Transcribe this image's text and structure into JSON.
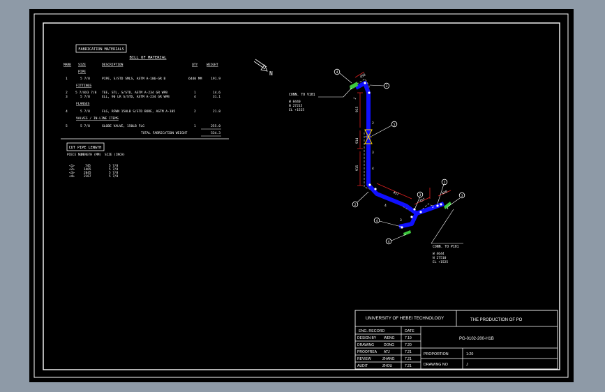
{
  "colors": {
    "background": "#000000",
    "viewport_frame": "#8e9aa7",
    "linework": "#ffffff",
    "pipe": "#1010ff",
    "dimension": "#e02020",
    "fitting": "#ffd400",
    "anchor": "#3ec83e"
  },
  "bom": {
    "badge": "FABRICATION MATERIALS",
    "title": "BILL OF MATERIAL",
    "headers": [
      "MARK",
      "SIZE",
      "DESCRIPTION",
      "QTY",
      "WEIGHT"
    ],
    "sections": [
      {
        "label": "PIPE",
        "rows": [
          {
            "mark": "1",
            "size": "5 7/8",
            "desc": "PIPE, S/STD SMLS, ASTM A-106-GR B",
            "qty": "6440 MM",
            "weight": "191.9"
          }
        ]
      },
      {
        "label": "FITTINGS",
        "rows": [
          {
            "mark": "2",
            "size": "5 7/8X3 7/8",
            "desc": "TEE, STL, S/STD, ASTM A-234 GR WPB",
            "qty": "1",
            "weight": "14.6"
          },
          {
            "mark": "3",
            "size": "5 7/8",
            "desc": "ELL, 90 LR S/STD, ASTM A-234 GR WPB",
            "qty": "4",
            "weight": "31.1"
          }
        ]
      },
      {
        "label": "FLANGES",
        "rows": [
          {
            "mark": "4",
            "size": "5 7/8",
            "desc": "FLG, RFWN 150LB S/STD BORE, ASTM A-105",
            "qty": "2",
            "weight": "21.8"
          }
        ]
      },
      {
        "label": "VALVES / IN-LINE ITEMS",
        "rows": [
          {
            "mark": "5",
            "size": "5 7/8",
            "desc": "GLOBE VALVE, 150LB FLG",
            "qty": "1",
            "weight": "255.0"
          }
        ]
      }
    ],
    "total_label": "TOTAL FABRICATION WEIGHT",
    "total_value": "534.3"
  },
  "cut": {
    "badge": "CUT PIPE LENGTH",
    "headers": [
      "PIECE NUM",
      "LENGTH (MM)",
      "SIZE (INCH)"
    ],
    "rows": [
      {
        "piece": "<1>",
        "length": "745",
        "size": "5 7/8"
      },
      {
        "piece": "<2>",
        "length": "1465",
        "size": "5 7/8"
      },
      {
        "piece": "<3>",
        "length": "2045",
        "size": "5 7/8"
      },
      {
        "piece": "<4>",
        "length": "2167",
        "size": "5 7/8"
      }
    ]
  },
  "iso": {
    "north": "N",
    "conn_upper": {
      "title": "CONN. TO V101",
      "lines": [
        "W 8440",
        "N 27215",
        "EL +1525"
      ]
    },
    "conn_lower": {
      "title": "CONN. TO P101",
      "lines": [
        "W 4644",
        "N 27510",
        "EL +1525"
      ]
    },
    "balloons": [
      "4",
      "3",
      "5",
      "2",
      "3",
      "2",
      "3",
      "4",
      "4"
    ],
    "pieces": [
      "1",
      "2",
      "3",
      "4",
      "4",
      "3",
      "2",
      "1"
    ],
    "dims": [
      "450",
      "915",
      "914",
      "915",
      "457",
      "457",
      "450"
    ]
  },
  "title_block": {
    "university": "UNIVERSITY OF HEBEI TECHNOLOGY",
    "production": "THE PRODUCTION OF PO",
    "col_record": "ENG. RECORD",
    "col_date": "DATE",
    "rows": [
      {
        "label": "DESIGN BY",
        "name": "WENG",
        "date": "7.19"
      },
      {
        "label": "DRAWING",
        "name": "DONG",
        "date": "7.20"
      },
      {
        "label": "PROOFREA",
        "name": "ATJ",
        "date": "7.21"
      },
      {
        "label": "REVIEW",
        "name": "ZHANG",
        "date": "7.21"
      },
      {
        "label": "AUDIT",
        "name": "ZHOU",
        "date": "7.21"
      }
    ],
    "drawing_id": "PG-0102-200-H1B",
    "proportion_label": "PROPORTION",
    "proportion_value": "1:20",
    "drawing_no_label": "DRAWING NO",
    "drawing_no_value": "J"
  }
}
